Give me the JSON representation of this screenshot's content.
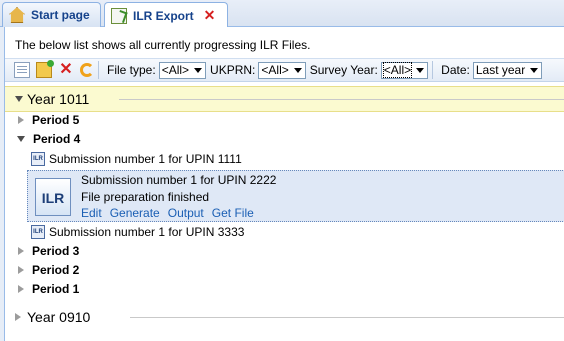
{
  "tabs": [
    {
      "label": "Start page"
    },
    {
      "label": "ILR Export"
    }
  ],
  "intro_text": "The below list shows all currently progressing ILR Files.",
  "toolbar": {
    "file_type_label": "File type:",
    "file_type_value": "<All>",
    "ukprn_label": "UKPRN:",
    "ukprn_value": "<All>",
    "survey_year_label": "Survey Year:",
    "survey_year_value": "<All>",
    "date_label": "Date:",
    "date_value": "Last year"
  },
  "tree": {
    "year_1011": "Year 1011",
    "period_5": "Period 5",
    "period_4": "Period 4",
    "sub_1111": "Submission number 1 for UPIN 1111",
    "selected": {
      "icon_text": "ILR",
      "title": "Submission number 1 for UPIN 2222",
      "status": "File preparation finished",
      "actions": [
        "Edit",
        "Generate",
        "Output",
        "Get File"
      ]
    },
    "sub_3333": "Submission number 1 for UPIN 3333",
    "period_3": "Period 3",
    "period_2": "Period 2",
    "period_1": "Period 1",
    "year_0910": "Year 0910",
    "small_icon_text": "ILR"
  }
}
